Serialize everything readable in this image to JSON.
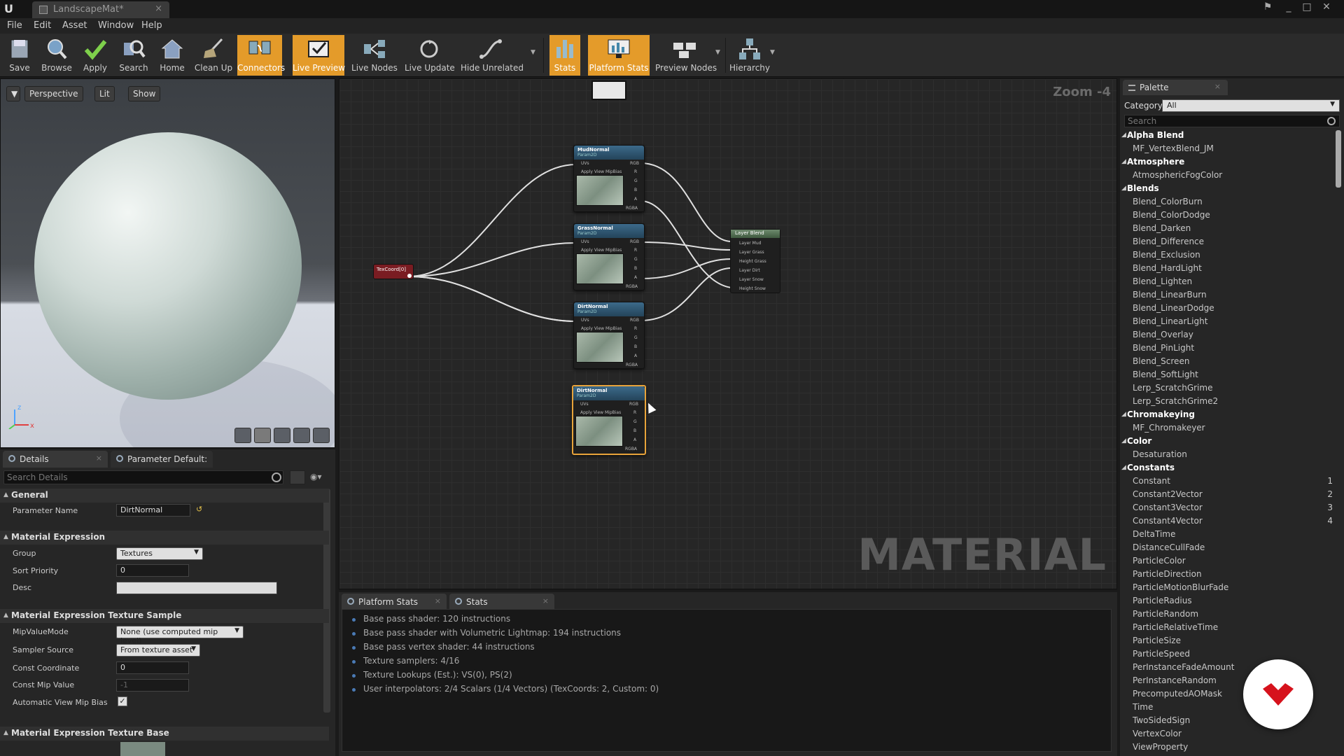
{
  "window": {
    "doc_tab": "LandscapeMat*",
    "close": "×"
  },
  "menu": [
    "File",
    "Edit",
    "Asset",
    "Window",
    "Help"
  ],
  "toolbar": {
    "buttons": [
      {
        "label": "Save",
        "icon": "save-icon",
        "active": false
      },
      {
        "label": "Browse",
        "icon": "browse-icon",
        "active": false
      },
      {
        "label": "Apply",
        "icon": "checkmark-icon",
        "active": false
      },
      {
        "label": "Search",
        "icon": "search-icon",
        "active": false
      },
      {
        "label": "Home",
        "icon": "home-icon",
        "active": false
      },
      {
        "label": "Clean Up",
        "icon": "broom-icon",
        "active": false
      },
      {
        "label": "Connectors",
        "icon": "connectors-icon",
        "active": true
      },
      {
        "label": "Live Preview",
        "icon": "live-preview-icon",
        "active": true
      },
      {
        "label": "Live Nodes",
        "icon": "live-nodes-icon",
        "active": false
      },
      {
        "label": "Live Update",
        "icon": "live-update-icon",
        "active": false
      },
      {
        "label": "Hide Unrelated",
        "icon": "hide-unrelated-icon",
        "active": false
      },
      {
        "label": "Stats",
        "icon": "stats-icon",
        "active": true
      },
      {
        "label": "Platform Stats",
        "icon": "platform-stats-icon",
        "active": true
      },
      {
        "label": "Preview Nodes",
        "icon": "preview-nodes-icon",
        "active": false
      },
      {
        "label": "Hierarchy",
        "icon": "hierarchy-icon",
        "active": false
      }
    ]
  },
  "viewport": {
    "perspective": "Perspective",
    "lit": "Lit",
    "show": "Show",
    "axis_x": "x",
    "axis_z": "z"
  },
  "details": {
    "tab_details": "Details",
    "tab_params": "Parameter Default:",
    "search_placeholder": "Search Details",
    "sections": {
      "general": "General",
      "material_expression": "Material Expression",
      "texture_sample": "Material Expression Texture Sample",
      "texture_base": "Material Expression Texture Base"
    },
    "props": {
      "parameter_name_label": "Parameter Name",
      "parameter_name_value": "DirtNormal",
      "group_label": "Group",
      "group_value": "Textures",
      "sort_priority_label": "Sort Priority",
      "sort_priority_value": "0",
      "desc_label": "Desc",
      "mip_value_mode_label": "MipValueMode",
      "mip_value_mode_value": "None (use computed mip level)",
      "sampler_source_label": "Sampler Source",
      "sampler_source_value": "From texture asset",
      "const_coordinate_label": "Const Coordinate",
      "const_coordinate_value": "0",
      "const_mip_value_label": "Const Mip Value",
      "const_mip_value_value": "-1",
      "auto_view_mip_bias_label": "Automatic View Mip Bias",
      "auto_view_mip_bias_checked": "✓"
    }
  },
  "graph": {
    "zoom": "Zoom -4",
    "watermark": "MATERIAL",
    "texcoord": "TexCoord[0]",
    "nodes": [
      {
        "title": "MudNormal",
        "sub": "Param2D"
      },
      {
        "title": "GrassNormal",
        "sub": "Param2D"
      },
      {
        "title": "DirtNormal",
        "sub": "Param2D"
      },
      {
        "title": "DirtNormal",
        "sub": "Param2D"
      }
    ],
    "pins_left": [
      "UVs",
      "Apply View MipBias"
    ],
    "pins_right": [
      "RGB",
      "R",
      "G",
      "B",
      "A",
      "RGBA"
    ],
    "layer_blend": {
      "title": "Layer Blend",
      "inputs": [
        "Layer Mud",
        "Layer Grass",
        "Height Grass",
        "Layer Dirt",
        "Layer Snow",
        "Height Snow"
      ]
    }
  },
  "bottom": {
    "tab_platform_stats": "Platform Stats",
    "tab_stats": "Stats",
    "lines": [
      "Base pass shader: 120 instructions",
      "Base pass shader with Volumetric Lightmap: 194 instructions",
      "Base pass vertex shader: 44 instructions",
      "Texture samplers: 4/16",
      "Texture Lookups (Est.): VS(0), PS(2)",
      "User interpolators: 2/4 Scalars (1/4 Vectors) (TexCoords: 2, Custom: 0)"
    ]
  },
  "palette": {
    "tab": "Palette",
    "category_label": "Category:",
    "category_value": "All",
    "search_placeholder": "Search",
    "rows": [
      {
        "type": "cat",
        "text": "Alpha Blend"
      },
      {
        "type": "item",
        "text": "MF_VertexBlend_JM"
      },
      {
        "type": "cat",
        "text": "Atmosphere"
      },
      {
        "type": "item",
        "text": "AtmosphericFogColor"
      },
      {
        "type": "cat",
        "text": "Blends"
      },
      {
        "type": "item",
        "text": "Blend_ColorBurn"
      },
      {
        "type": "item",
        "text": "Blend_ColorDodge"
      },
      {
        "type": "item",
        "text": "Blend_Darken"
      },
      {
        "type": "item",
        "text": "Blend_Difference"
      },
      {
        "type": "item",
        "text": "Blend_Exclusion"
      },
      {
        "type": "item",
        "text": "Blend_HardLight"
      },
      {
        "type": "item",
        "text": "Blend_Lighten"
      },
      {
        "type": "item",
        "text": "Blend_LinearBurn"
      },
      {
        "type": "item",
        "text": "Blend_LinearDodge"
      },
      {
        "type": "item",
        "text": "Blend_LinearLight"
      },
      {
        "type": "item",
        "text": "Blend_Overlay"
      },
      {
        "type": "item",
        "text": "Blend_PinLight"
      },
      {
        "type": "item",
        "text": "Blend_Screen"
      },
      {
        "type": "item",
        "text": "Blend_SoftLight"
      },
      {
        "type": "item",
        "text": "Lerp_ScratchGrime"
      },
      {
        "type": "item",
        "text": "Lerp_ScratchGrime2"
      },
      {
        "type": "cat",
        "text": "Chromakeying"
      },
      {
        "type": "item",
        "text": "MF_Chromakeyer"
      },
      {
        "type": "cat",
        "text": "Color"
      },
      {
        "type": "item",
        "text": "Desaturation"
      },
      {
        "type": "cat",
        "text": "Constants"
      },
      {
        "type": "item",
        "text": "Constant",
        "hotkey": "1"
      },
      {
        "type": "item",
        "text": "Constant2Vector",
        "hotkey": "2"
      },
      {
        "type": "item",
        "text": "Constant3Vector",
        "hotkey": "3"
      },
      {
        "type": "item",
        "text": "Constant4Vector",
        "hotkey": "4"
      },
      {
        "type": "item",
        "text": "DeltaTime"
      },
      {
        "type": "item",
        "text": "DistanceCullFade"
      },
      {
        "type": "item",
        "text": "ParticleColor"
      },
      {
        "type": "item",
        "text": "ParticleDirection"
      },
      {
        "type": "item",
        "text": "ParticleMotionBlurFade"
      },
      {
        "type": "item",
        "text": "ParticleRadius"
      },
      {
        "type": "item",
        "text": "ParticleRandom"
      },
      {
        "type": "item",
        "text": "ParticleRelativeTime"
      },
      {
        "type": "item",
        "text": "ParticleSize"
      },
      {
        "type": "item",
        "text": "ParticleSpeed"
      },
      {
        "type": "item",
        "text": "PerInstanceFadeAmount"
      },
      {
        "type": "item",
        "text": "PerInstanceRandom"
      },
      {
        "type": "item",
        "text": "PrecomputedAOMask"
      },
      {
        "type": "item",
        "text": "Time"
      },
      {
        "type": "item",
        "text": "TwoSidedSign"
      },
      {
        "type": "item",
        "text": "VertexColor"
      },
      {
        "type": "item",
        "text": "ViewProperty"
      }
    ]
  },
  "colors": {
    "accent_active": "#e49b2a",
    "node_header": "#3c6a8a",
    "texcoord_node": "#7a1c22",
    "selection": "#e8a33a",
    "brand_red": "#d6121c"
  }
}
